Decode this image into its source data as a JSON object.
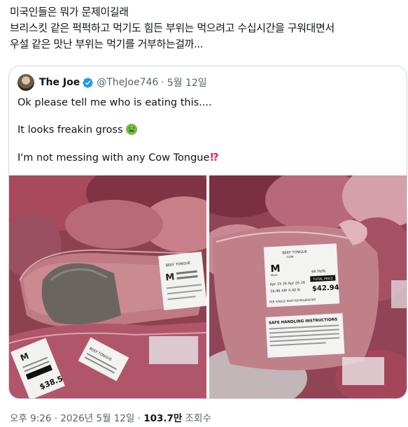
{
  "post": {
    "lines": [
      "미국인들은 뭐가 문제이길래",
      "브리스킷 같은 퍽퍽하고 먹기도 힘든 부위는 먹으려고 수십시간을 구워대면서",
      "우설 같은 맛난 부위는 먹기를 거부하는걸까..."
    ]
  },
  "quote": {
    "display_name": "The Joe",
    "handle": "@TheJoe746",
    "separator": "·",
    "date": "5월 12일",
    "line1": "Ok please tell me who is eating this....",
    "line2": "It looks freakin gross",
    "line3": "I'm not messing with any Cow Tongue",
    "line3_emoji": "⁉",
    "icons": [
      "avatar",
      "verified-badge-icon",
      "nauseated-face-emoji",
      "interrobang-emoji"
    ]
  },
  "photos": {
    "left": {
      "label_top": "BEEF TONGUE",
      "label_brand": "M",
      "label_price": "$38.5",
      "label_side": "BEEF TONGUE"
    },
    "right": {
      "label_title": "BEEF TONGUE",
      "label_sub": "COW",
      "label_brand": "M",
      "label_brand_sub": "Mark",
      "label_date1": "Apr 15 26",
      "label_date2": "Apr 26 26",
      "label_time": "16:46 AM",
      "label_weight": "4.40 lb",
      "label_unit_price": "$9.76/lb",
      "label_total_caption": "TOTAL PRICE",
      "label_total": "$42.94",
      "label_keep": "PER SINGLE KEEP REFRIGERATED",
      "label_safe": "SAFE HANDLING INSTRUCTIONS"
    }
  },
  "footer": {
    "time": "오후 9:26",
    "sep1": "·",
    "date": "2026년 5월 12일",
    "sep2": "·",
    "views": "103.7만",
    "views_label": "조회수"
  },
  "colors": {
    "text": "#0f1419",
    "secondary": "#536471",
    "border": "#cfd9de",
    "verified": "#1d9bf0"
  }
}
